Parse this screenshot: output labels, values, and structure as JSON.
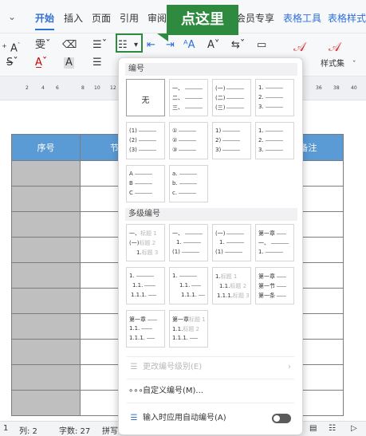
{
  "tabs": {
    "dropdown": "⌄",
    "start": "开始",
    "insert": "插入",
    "page": "页面",
    "reference": "引用",
    "review": "审阅",
    "vip": "会员专享",
    "table_tools": "表格工具",
    "table_style": "表格样式"
  },
  "callout": {
    "text": "点这里"
  },
  "ribbon": {
    "style_set": "样式集"
  },
  "ruler": {
    "numbers": [
      "2",
      "4",
      "6",
      "8",
      "10",
      "12",
      "36",
      "38",
      "40"
    ]
  },
  "table": {
    "header_seq": "序号",
    "header_partial": "节",
    "header_note": "备注"
  },
  "panel": {
    "numbering_title": "编号",
    "none_label": "无",
    "multilevel_title": "多级编号",
    "heading_hint_1": "标题 1",
    "heading_hint_2": "标题 2",
    "heading_hint_3": "标题 3",
    "chapter": "第一章",
    "section": "第一节",
    "article": "第一条",
    "change_level": "更改编号级别(E)",
    "custom_numbering": "自定义编号(M)...",
    "auto_numbering": "输入时应用自动编号(A)"
  },
  "status": {
    "col": "列: 2",
    "words": "字数: 27",
    "spell": "拼写"
  },
  "colors": {
    "accent": "#2f6fd6",
    "callout": "#2d8a3e",
    "table_header": "#5b9bd5"
  }
}
